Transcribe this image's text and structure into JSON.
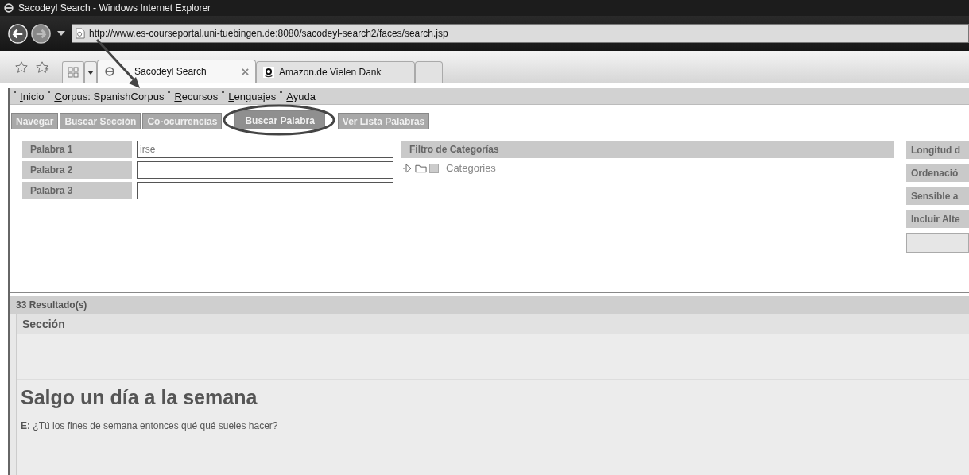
{
  "window": {
    "title": "Sacodeyl Search - Windows Internet Explorer"
  },
  "address": {
    "url": "http://www.es-courseportal.uni-tuebingen.de:8080/sacodeyl-search2/faces/search.jsp"
  },
  "browser_tabs": [
    {
      "label": "Sacodeyl Search",
      "selected": true,
      "kind": "ie"
    },
    {
      "label": "Amazon.de Vielen Dank",
      "selected": false,
      "kind": "amazon"
    }
  ],
  "menu": [
    "Inicio",
    "Corpus: SpanishCorpus",
    "Recursos",
    "Lenguajes",
    "Ayuda"
  ],
  "page_tabs": [
    {
      "label": "Navegar",
      "selected": false
    },
    {
      "label": "Buscar Sección",
      "selected": false
    },
    {
      "label": "Co-ocurrencias",
      "selected": false
    },
    {
      "label": "Buscar Palabra",
      "selected": true
    },
    {
      "label": "Ver Lista Palabras",
      "selected": false
    }
  ],
  "words": [
    {
      "label": "Palabra 1",
      "value": "irse"
    },
    {
      "label": "Palabra 2"
    },
    {
      "label": "Palabra 3"
    }
  ],
  "filter": {
    "title": "Filtro de Categorías",
    "tree": [
      {
        "label": "Categories",
        "expanded": false,
        "checked": false
      }
    ]
  },
  "options": [
    "Longitud d",
    "Ordenació",
    "Sensible a",
    "Incluir Alte"
  ],
  "results": {
    "count": "33 Resultado(s)",
    "column": "Sección",
    "title": "Salgo un día a la semana",
    "line": "**E:** ¿Tú los fines de semana entonces qué qué sueles hacer?"
  }
}
